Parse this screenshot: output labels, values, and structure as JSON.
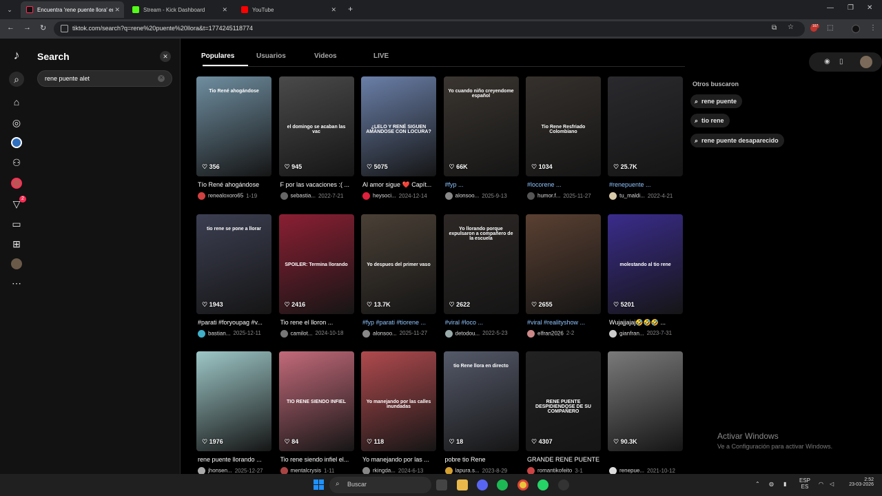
{
  "browser": {
    "tabs": [
      {
        "title": "Encuentra 'rene puente llora' en TikTok",
        "color": "#fe2c55"
      },
      {
        "title": "Stream - Kick Dashboard",
        "color": "#53fc18"
      },
      {
        "title": "YouTube",
        "color": "#ff0000"
      }
    ],
    "url": "tiktok.com/search?q=rene%20puente%20llora&t=1774245118774",
    "ext_badge": "167"
  },
  "sidebar": {
    "notif_badge": "2"
  },
  "search_panel": {
    "title": "Search",
    "input_value": "rene puente alet"
  },
  "main": {
    "tabs": [
      "Populares",
      "Usuarios",
      "Videos",
      "LIVE"
    ],
    "related_title": "Otros buscaron",
    "related": [
      "rene puente",
      "tio rene",
      "rene puente desaparecido"
    ]
  },
  "videos": [
    {
      "likes": "356",
      "desc": "Tío René ahogándose",
      "user": "renealoxoro65",
      "date": "1-19",
      "tag": false,
      "overlay": "Tio René ahogándose",
      "bg": "#6f8ea0",
      "av": "#d04040"
    },
    {
      "likes": "945",
      "desc": "F por las vacaciones :( ...",
      "user": "sebastia...",
      "date": "2022-7-21",
      "tag": false,
      "overlay": "el domingo se acaban las vac",
      "bg": "#4a4a4a",
      "av": "#666"
    },
    {
      "likes": "5075",
      "desc": "Al amor sigue ❤️ Capít...",
      "user": "heysoci...",
      "date": "2024-12-14",
      "tag": false,
      "overlay": "¿LELO Y RENÉ SIGUEN AMÁNDOSE CON LOCURA?",
      "bg": "#6a7fa8",
      "av": "#e0203c"
    },
    {
      "likes": "66K",
      "desc": "#fyp ...",
      "user": "alonsoo...",
      "date": "2025-9-13",
      "tag": true,
      "overlay": "Yo cuando niño creyendome español",
      "bg": "#3a3530",
      "av": "#888"
    },
    {
      "likes": "1034",
      "desc": "#locorene ...",
      "user": "humor.f...",
      "date": "2025-11-27",
      "tag": true,
      "overlay": "Tio Rene Resfriado Colombiano",
      "bg": "#35302c",
      "av": "#555"
    },
    {
      "likes": "25.7K",
      "desc": "#renepuente ...",
      "user": "tu_maldi...",
      "date": "2022-4-21",
      "tag": true,
      "overlay": "",
      "bg": "#2a2a2e",
      "av": "#d8c9a8"
    },
    {
      "likes": "1943",
      "desc": "#parati #foryoupag #v...",
      "user": "bastian...",
      "date": "2025-12-11",
      "tag": false,
      "overlay": "tio rene se pone a llorar",
      "bg": "#3c3f52",
      "av": "#3fb0c8"
    },
    {
      "likes": "2416",
      "desc": "Tio rene el lloron ...",
      "user": "camilot...",
      "date": "2024-10-18",
      "tag": false,
      "overlay": "SPOILER: Termina llorando",
      "bg": "#8b1f33",
      "av": "#777"
    },
    {
      "likes": "13.7K",
      "desc": "#fyp #parati #tiorene ...",
      "user": "alonsoo...",
      "date": "2025-11-27",
      "tag": true,
      "overlay": "Yo despues del primer vaso",
      "bg": "#4a4036",
      "av": "#888"
    },
    {
      "likes": "2622",
      "desc": "#viral #loco ...",
      "user": "detodou...",
      "date": "2022-5-23",
      "tag": true,
      "overlay": "Yo llorando porque expulsaron a compañero de la escuela",
      "bg": "#2d2826",
      "av": "#9aa"
    },
    {
      "likes": "2655",
      "desc": "#viral #realityshow ...",
      "user": "elfran2026",
      "date": "2-2",
      "tag": true,
      "overlay": "",
      "bg": "#5a4032",
      "av": "#c88"
    },
    {
      "likes": "5201",
      "desc": "Wujajjajaj🤣🤣🤣 ...",
      "user": "gianfran...",
      "date": "2023-7-31",
      "tag": false,
      "overlay": "molestando al tio rene",
      "bg": "#3a2c8c",
      "av": "#ccc"
    },
    {
      "likes": "1976",
      "desc": "rene puente llorando ...",
      "user": "jhonsen...",
      "date": "2025-12-27",
      "tag": false,
      "overlay": "",
      "bg": "#9ec7c7",
      "av": "#aaa"
    },
    {
      "likes": "84",
      "desc": "Tio rene siendo infiel el...",
      "user": "mentalcrysis",
      "date": "1-11",
      "tag": false,
      "overlay": "TIO RENE SIENDO INFIEL",
      "bg": "#c36a7a",
      "av": "#a44"
    },
    {
      "likes": "118",
      "desc": "Yo manejando por las ...",
      "user": "rkingda...",
      "date": "2024-6-13",
      "tag": false,
      "overlay": "Yo manejando por las calles inundadas",
      "bg": "#b04a4e",
      "av": "#888"
    },
    {
      "likes": "18",
      "desc": "pobre tio Rene",
      "user": "lapura.s...",
      "date": "2023-8-29",
      "tag": false,
      "overlay": "tio Rene llora en directo",
      "bg": "#555a6a",
      "av": "#d4a030"
    },
    {
      "likes": "4307",
      "desc": "GRANDE RENE PUENTE",
      "user": "romantikofeito",
      "date": "3-1",
      "tag": false,
      "overlay": "RENE PUENTE DESPIDIENDOSE DE SU COMPAÑERO",
      "bg": "#222",
      "av": "#c44"
    },
    {
      "likes": "90.3K",
      "desc": "",
      "user": "renepue...",
      "date": "2021-10-12",
      "tag": false,
      "overlay": "",
      "bg": "#7a7a7a",
      "av": "#ddd"
    }
  ],
  "watermark": {
    "line1": "Activar Windows",
    "line2": "Ve a Configuración para activar Windows."
  },
  "taskbar": {
    "search": "Buscar",
    "lang1": "ESP",
    "lang2": "ES",
    "time": "2:52",
    "date": "23-03-2026"
  }
}
